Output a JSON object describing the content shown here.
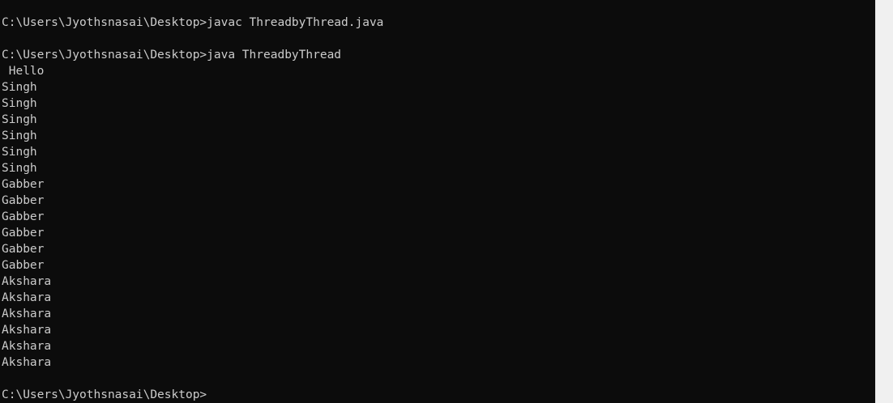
{
  "console": {
    "background": "#0c0c0c",
    "foreground": "#cccccc",
    "lines": [
      "C:\\Users\\Jyothsnasai\\Desktop>javac ThreadbyThread.java",
      "",
      "C:\\Users\\Jyothsnasai\\Desktop>java ThreadbyThread",
      " Hello",
      "Singh",
      "Singh",
      "Singh",
      "Singh",
      "Singh",
      "Singh",
      "Gabber",
      "Gabber",
      "Gabber",
      "Gabber",
      "Gabber",
      "Gabber",
      "Akshara",
      "Akshara",
      "Akshara",
      "Akshara",
      "Akshara",
      "Akshara",
      "",
      "C:\\Users\\Jyothsnasai\\Desktop>"
    ]
  },
  "scrollbar": {
    "background": "#f0f0f0"
  }
}
